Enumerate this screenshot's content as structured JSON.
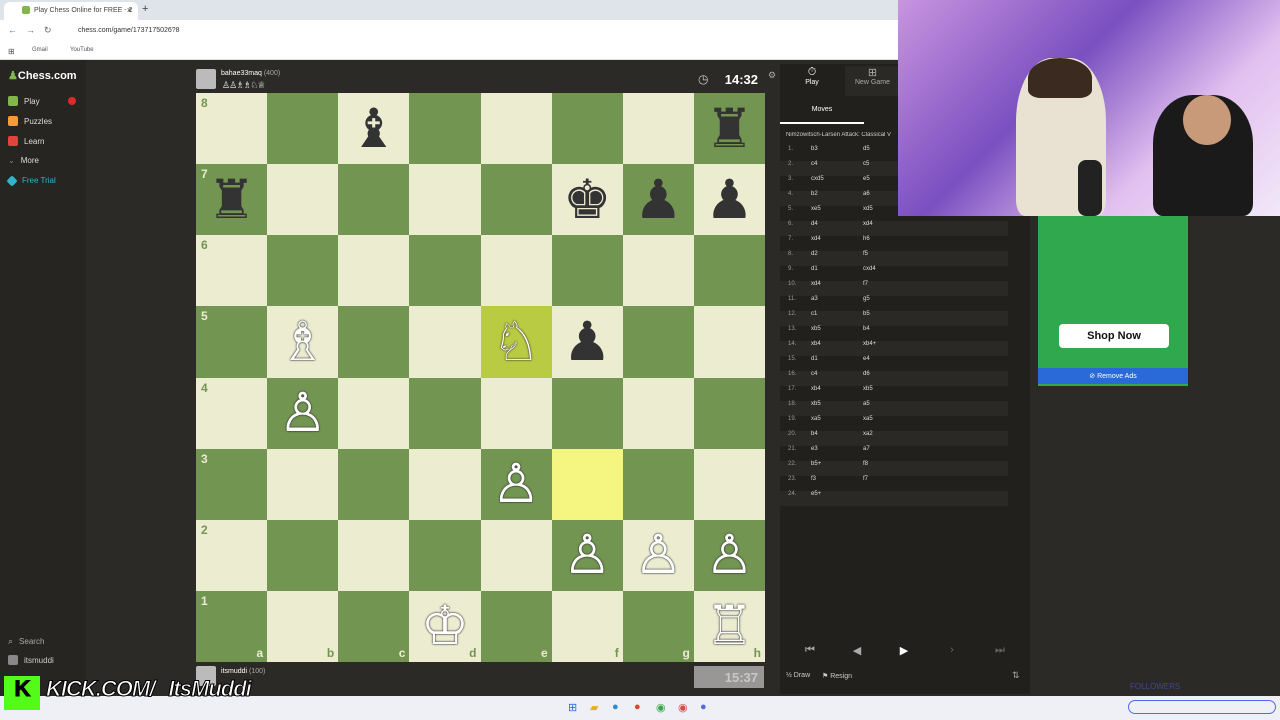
{
  "browser": {
    "tab_title": "Play Chess Online for FREE - 2",
    "url": "chess.com/game/1737175026?8",
    "bookmarks": [
      "Gmail",
      "YouTube"
    ]
  },
  "sidebar": {
    "logo": "Chess.com",
    "items": [
      {
        "label": "Play",
        "color": "#81b64c"
      },
      {
        "label": "Puzzles",
        "color": "#f29d36"
      },
      {
        "label": "Learn",
        "color": "#e0443b"
      },
      {
        "label": "More",
        "color": "#888888"
      },
      {
        "label": "Free Trial",
        "color": "#2fb5c9"
      }
    ],
    "search": "Search",
    "user": "itsmuddi"
  },
  "opponent": {
    "name": "bahae33maq",
    "rating": "(400)",
    "clock": "14:32"
  },
  "player": {
    "name": "itsmuddi",
    "rating": "(100)",
    "clock": "15:37"
  },
  "board": {
    "ranks": [
      "8",
      "7",
      "6",
      "5",
      "4",
      "3",
      "2",
      "1"
    ],
    "files": [
      "a",
      "b",
      "c",
      "d",
      "e",
      "f",
      "g",
      "h"
    ],
    "highlights": [
      "e5",
      "f3"
    ],
    "pieces": {
      "c8": "♝b",
      "h8": "♜b",
      "a7": "♜b",
      "f7": "♚b",
      "g7": "♟b",
      "h7": "♟b",
      "b5": "♗w",
      "e5": "♘w",
      "f5": "♟b",
      "b4": "♙w",
      "e3": "♙w",
      "f2": "♙w",
      "g2": "♙w",
      "h2": "♙w",
      "d1": "♔w",
      "h1": "♖w"
    }
  },
  "panel": {
    "tab_play": "Play",
    "tab_new": "New Game",
    "moves_tab": "Moves",
    "opening": "Nimzowitsch-Larsen Attack: Classical V",
    "moves": [
      [
        "1.",
        "b3",
        "d5"
      ],
      [
        "2.",
        "c4",
        "c5"
      ],
      [
        "3.",
        "cxd5",
        "e5"
      ],
      [
        "4.",
        "b2",
        "a6"
      ],
      [
        "5.",
        "xe5",
        "xd5"
      ],
      [
        "6.",
        "d4",
        "xd4"
      ],
      [
        "7.",
        "xd4",
        "h6"
      ],
      [
        "8.",
        "d2",
        "f5"
      ],
      [
        "9.",
        "d1",
        "cxd4"
      ],
      [
        "10.",
        "xd4",
        "f7"
      ],
      [
        "11.",
        "a3",
        "g5"
      ],
      [
        "12.",
        "c1",
        "b5"
      ],
      [
        "13.",
        "xb5",
        "b4"
      ],
      [
        "14.",
        "xb4",
        "xb4+"
      ],
      [
        "15.",
        "d1",
        "e4"
      ],
      [
        "16.",
        "c4",
        "d6"
      ],
      [
        "17.",
        "xb4",
        "xb5"
      ],
      [
        "18.",
        "xb5",
        "a5"
      ],
      [
        "19.",
        "xa5",
        "xa5"
      ],
      [
        "20.",
        "b4",
        "xa2"
      ],
      [
        "21.",
        "e3",
        "a7"
      ],
      [
        "22.",
        "b5+",
        "f8"
      ],
      [
        "23.",
        "f3",
        "f7"
      ],
      [
        "24.",
        "e5+",
        ""
      ]
    ],
    "draw": "Draw",
    "resign": "Resign"
  },
  "ad": {
    "button": "Shop Now",
    "remove": "Remove Ads"
  },
  "overlay": {
    "kick": "KICK.COM/",
    "handle": "ItsMuddi",
    "followers": "FOLLOWERS"
  }
}
